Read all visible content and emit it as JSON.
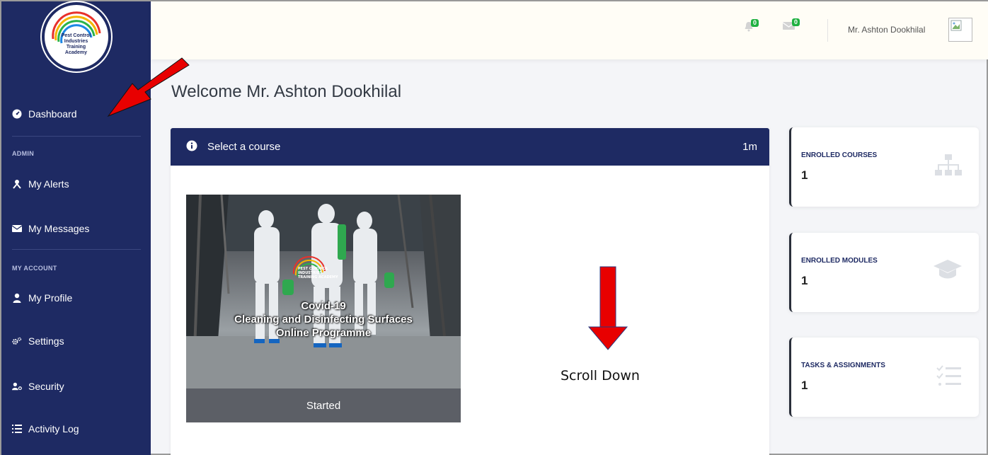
{
  "brand": {
    "logo_text": [
      "Pest Control",
      "Industries",
      "Training",
      "Academy"
    ]
  },
  "sidebar": {
    "dashboard": "Dashboard",
    "admin_label": "ADMIN",
    "my_alerts": "My Alerts",
    "my_messages": "My Messages",
    "account_label": "MY ACCOUNT",
    "my_profile": "My Profile",
    "settings": "Settings",
    "security": "Security",
    "activity_log": "Activity Log"
  },
  "topbar": {
    "alerts_count": "0",
    "messages_count": "0",
    "user_name": "Mr. Ashton Dookhilal"
  },
  "welcome": "Welcome Mr. Ashton Dookhilal",
  "panel": {
    "title": "Select a course",
    "time": "1m"
  },
  "course": {
    "badge_text": "PEST CONTROL\nINDUSTRIES\nTRAINING ACADEMY",
    "title_line1": "Covid-19",
    "title_line2": "Cleaning and Disinfecting Surfaces",
    "title_line3": "Online Programme",
    "status": "Started"
  },
  "annotation": {
    "scroll_text": "Scroll Down"
  },
  "stats": [
    {
      "label": "ENROLLED COURSES",
      "value": "1",
      "icon": "sitemap-icon"
    },
    {
      "label": "ENROLLED MODULES",
      "value": "1",
      "icon": "graduation-cap-icon"
    },
    {
      "label": "TASKS & ASSIGNMENTS",
      "value": "1",
      "icon": "task-list-icon"
    }
  ],
  "colors": {
    "sidebar": "#1e2a63",
    "badge": "#1fb141",
    "annotation_arrow": "#ff0000"
  }
}
